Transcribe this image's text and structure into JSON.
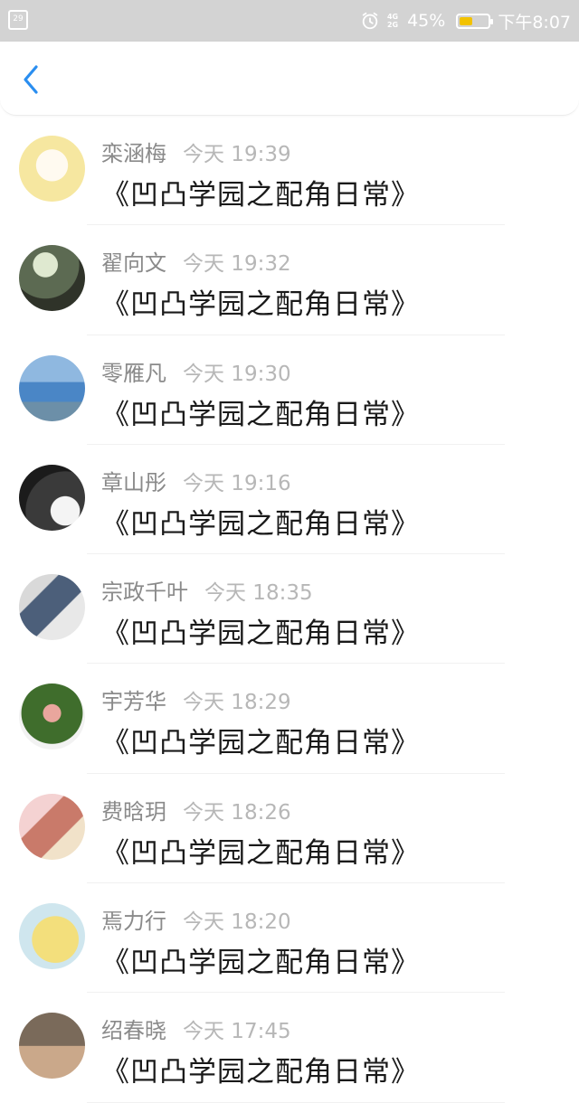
{
  "status_bar": {
    "calendar_day": "29",
    "network": [
      "4G",
      "2G"
    ],
    "battery_percent_text": "45%",
    "battery_level": 0.45,
    "clock": "下午8:07"
  },
  "nav": {
    "back_icon": "chevron-left-icon",
    "accent": "#2a8ef0"
  },
  "items": [
    {
      "name": "栾涵梅",
      "time": "今天 19:39",
      "message": "《凹凸学园之配角日常》"
    },
    {
      "name": "翟向文",
      "time": "今天 19:32",
      "message": "《凹凸学园之配角日常》"
    },
    {
      "name": "零雁凡",
      "time": "今天 19:30",
      "message": "《凹凸学园之配角日常》"
    },
    {
      "name": "章山彤",
      "time": "今天 19:16",
      "message": "《凹凸学园之配角日常》"
    },
    {
      "name": "宗政千叶",
      "time": "今天 18:35",
      "message": "《凹凸学园之配角日常》"
    },
    {
      "name": "宇芳华",
      "time": "今天 18:29",
      "message": "《凹凸学园之配角日常》"
    },
    {
      "name": "费晗玥",
      "time": "今天 18:26",
      "message": "《凹凸学园之配角日常》"
    },
    {
      "name": "焉力行",
      "time": "今天 18:20",
      "message": "《凹凸学园之配角日常》"
    },
    {
      "name": "绍春晓",
      "time": "今天 17:45",
      "message": "《凹凸学园之配角日常》"
    }
  ]
}
